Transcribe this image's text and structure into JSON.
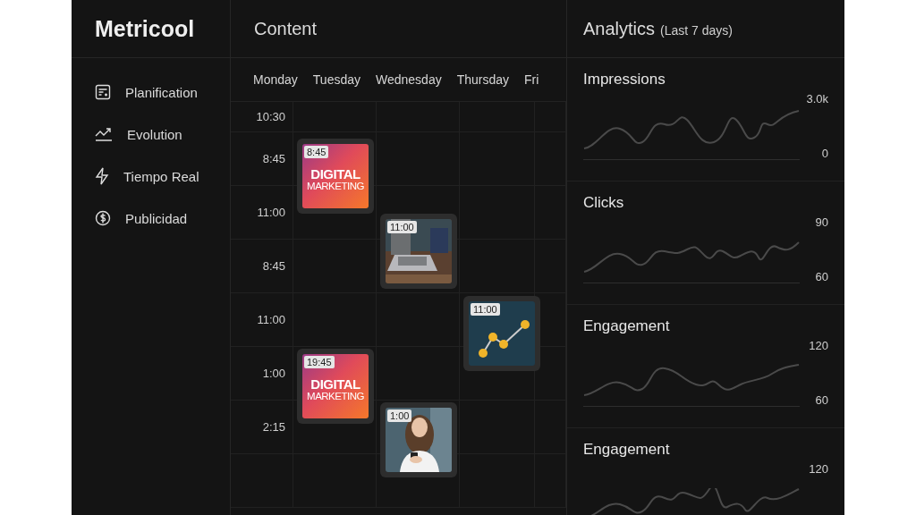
{
  "sidebar": {
    "logo": "Metricool",
    "items": [
      {
        "label": "Planification"
      },
      {
        "label": "Evolution"
      },
      {
        "label": "Tiempo Real"
      },
      {
        "label": "Publicidad"
      }
    ]
  },
  "content": {
    "title": "Content",
    "days": [
      "Monday",
      "Tuesday",
      "Wednesday",
      "Thursday",
      "Fri"
    ],
    "times": [
      "10:30",
      "8:45",
      "11:00",
      "8:45",
      "11:00",
      "1:00",
      "2:15"
    ],
    "posts": [
      {
        "kind": "graphic",
        "time": "8:45",
        "headline": "DIGITAL",
        "subline": "MARKETING"
      },
      {
        "time": "11:00"
      },
      {
        "kind": "chart",
        "time": "11:00"
      },
      {
        "kind": "graphic",
        "time": "19:45",
        "headline": "DIGITAL",
        "subline": "MARKETING"
      },
      {
        "time": "1:00"
      }
    ]
  },
  "analytics": {
    "title": "Analytics",
    "subtitle": "(Last 7 days)",
    "metrics": [
      {
        "name": "Impressions",
        "max": "3.0k",
        "min": "0"
      },
      {
        "name": "Clicks",
        "max": "90",
        "min": "60"
      },
      {
        "name": "Engagement",
        "max": "120",
        "min": "60"
      },
      {
        "name": "Engagement",
        "max": "120"
      }
    ]
  }
}
